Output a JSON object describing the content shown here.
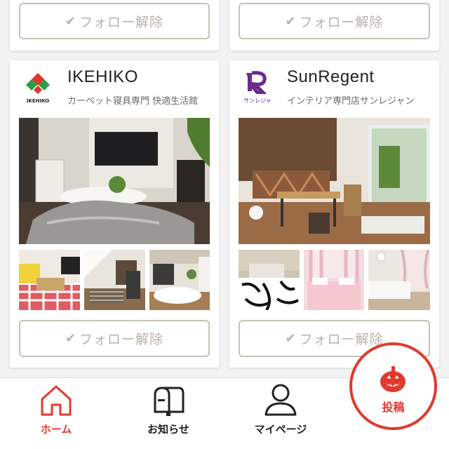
{
  "follow_label": "フォロー解除",
  "check_glyph": "✔",
  "cards_top": [
    {
      "follow_label": "フォロー解除"
    },
    {
      "follow_label": "フォロー解除"
    }
  ],
  "shops": [
    {
      "name": "IKEHIKO",
      "description": "カーペット寝具専門 快適生活館",
      "logo_text": "IKEHIKO",
      "follow_label": "フォロー解除",
      "photo_main": "living-room-kotatsu",
      "photos": [
        "yellow-sofa-checked-rug",
        "attic-bedroom",
        "futon-living"
      ]
    },
    {
      "name": "SunRegent",
      "description": "インテリア専門店サンレジャン",
      "logo_text": "サンレジャ",
      "follow_label": "フォロー解除",
      "photo_main": "kitchen-dining",
      "photos": [
        "zebra-bed",
        "pink-bedroom",
        "white-bedroom"
      ]
    }
  ],
  "tabbar": {
    "home": {
      "label": "ホーム",
      "icon": "home-icon"
    },
    "notifications": {
      "label": "お知らせ",
      "icon": "mailbox-icon"
    },
    "mypage": {
      "label": "マイページ",
      "icon": "user-icon"
    },
    "post": {
      "label": "投稿",
      "icon": "pumpkin-icon"
    }
  },
  "colors": {
    "accent": "#e03a2f",
    "button_border": "#c9c2b5",
    "button_text": "#b9b2a8",
    "sunregent_purple": "#6a2a8c"
  }
}
